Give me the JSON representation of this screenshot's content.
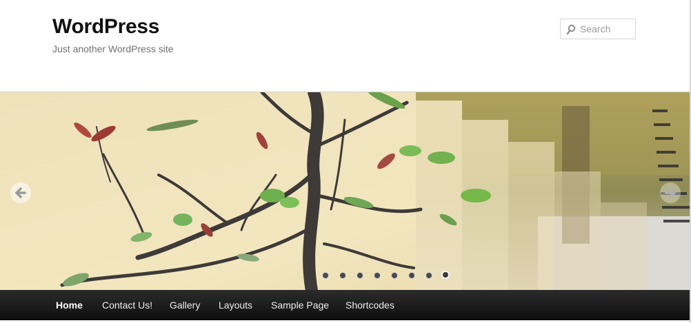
{
  "site": {
    "title": "WordPress",
    "description": "Just another WordPress site"
  },
  "search": {
    "placeholder": "Search",
    "icon": "magnifier-icon"
  },
  "slider": {
    "description_of_content": "",
    "prev_icon": "arrow-left-icon",
    "next_icon": "arrow-right-icon",
    "slide_count": 8,
    "active_slide": 8
  },
  "nav": {
    "items": [
      {
        "label": "Home",
        "current": true
      },
      {
        "label": "Contact Us!",
        "current": false
      },
      {
        "label": "Gallery",
        "current": false
      },
      {
        "label": "Layouts",
        "current": false
      },
      {
        "label": "Sample Page",
        "current": false
      },
      {
        "label": "Shortcodes",
        "current": false
      }
    ]
  },
  "colors": {
    "nav_background": "#1a1a1a",
    "title_color": "#111111",
    "description_color": "#707070"
  }
}
